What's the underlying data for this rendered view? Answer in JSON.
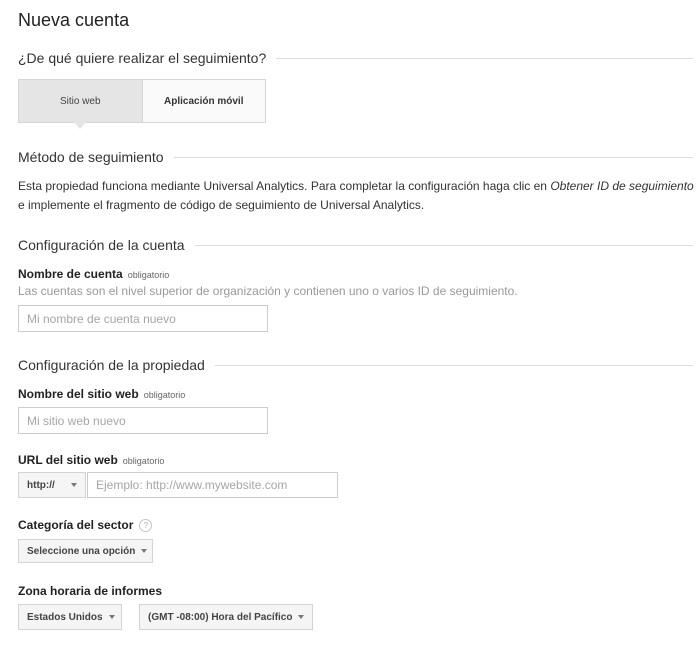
{
  "page": {
    "title": "Nueva cuenta"
  },
  "tracking": {
    "section_label": "¿De qué quiere realizar el seguimiento?",
    "options": [
      {
        "label": "Sitio web",
        "selected": true
      },
      {
        "label": "Aplicación móvil",
        "selected": false
      }
    ]
  },
  "method": {
    "section_label": "Método de seguimiento",
    "line1_text": "Esta propiedad funciona mediante Universal Analytics. Para completar la configuración haga clic en ",
    "line1_emphasis": "Obtener ID de seguimiento",
    "line2_text": "e implemente el fragmento de código de seguimiento de Universal Analytics."
  },
  "account": {
    "section_label": "Configuración de la cuenta",
    "name_label": "Nombre de cuenta",
    "required_label": "obligatorio",
    "help_text": "Las cuentas son el nivel superior de organización y contienen uno o varios ID de seguimiento.",
    "name_value": "",
    "name_placeholder": "Mi nombre de cuenta nuevo"
  },
  "property": {
    "section_label": "Configuración de la propiedad",
    "site_name_label": "Nombre del sitio web",
    "site_name_required": "obligatorio",
    "site_name_value": "",
    "site_name_placeholder": "Mi sitio web nuevo",
    "url_label": "URL del sitio web",
    "url_required": "obligatorio",
    "protocol_selected": "http://",
    "url_value": "",
    "url_placeholder": "Ejemplo: http://www.mywebsite.com",
    "category_label": "Categoría del sector",
    "category_help_glyph": "?",
    "category_selected": "Seleccione una opción",
    "timezone_label": "Zona horaria de informes",
    "country_selected": "Estados Unidos",
    "timezone_selected": "(GMT -08:00) Hora del Pacífico"
  }
}
